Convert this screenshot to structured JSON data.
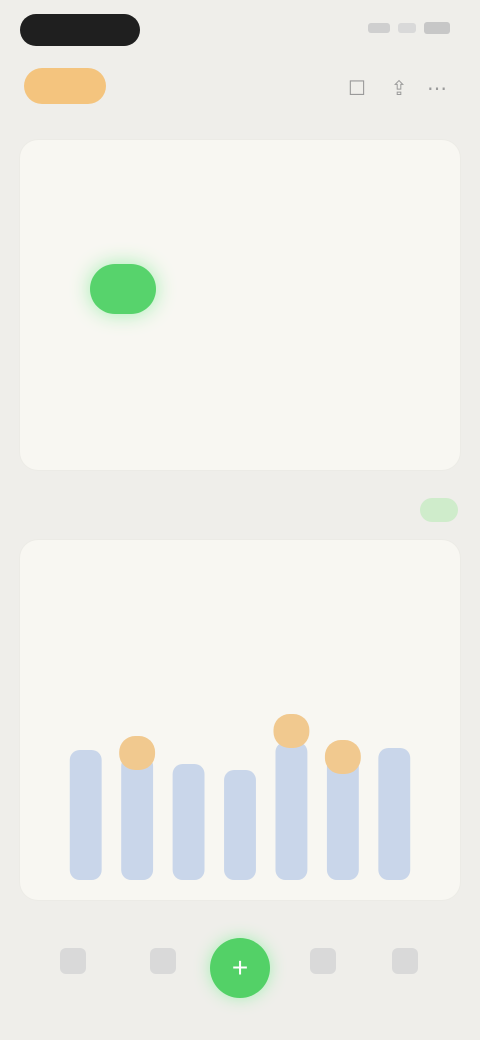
{
  "status": {
    "pill": ""
  },
  "header": {
    "plan_label": "",
    "title": "",
    "icon1": "bookmark-icon",
    "icon2": "share-icon",
    "icon3": "more-icon"
  },
  "top_card": {
    "title": "",
    "levels": [
      "",
      "",
      ""
    ]
  },
  "section": {
    "title": "",
    "badge": ""
  },
  "stats": [
    {
      "label": "",
      "value": ""
    },
    {
      "label": "",
      "value": ""
    }
  ],
  "chart_axis": {
    "left": "",
    "right": ""
  },
  "colors": {
    "accent_green": "#53d167",
    "accent_orange": "#f4c47e",
    "bar_blue": "#c9d6ea",
    "bar_orange": "#f1c98f"
  },
  "chart_data": {
    "type": "bar",
    "categories": [
      "",
      "",
      "",
      "",
      "",
      "",
      ""
    ],
    "values": [
      65,
      62,
      58,
      55,
      69,
      62,
      66
    ],
    "highlights": [
      null,
      72,
      null,
      null,
      83,
      70,
      null
    ],
    "ylim": [
      0,
      100
    ]
  },
  "bottom_nav": {
    "items": [
      {
        "label": ""
      },
      {
        "label": ""
      },
      {
        "label": ""
      },
      {
        "label": ""
      }
    ],
    "center_icon": "plus-icon"
  }
}
